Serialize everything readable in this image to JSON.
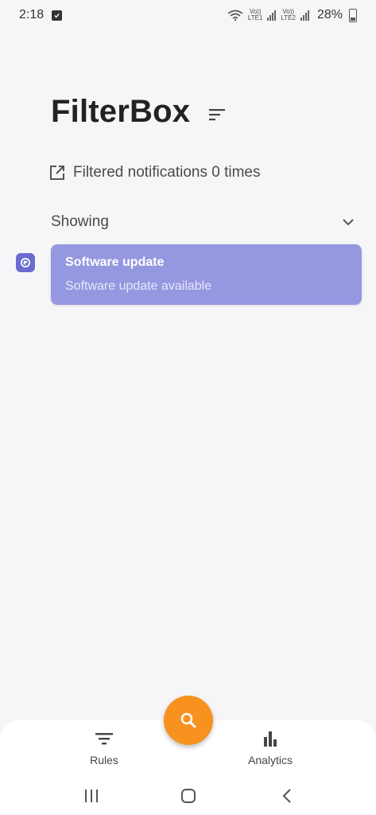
{
  "status_bar": {
    "time": "2:18",
    "network_tag_1_top": "Vo))",
    "network_tag_1_bottom": "LTE1",
    "network_tag_2_top": "Vo))",
    "network_tag_2_bottom": "LTE2",
    "battery": "28%"
  },
  "header": {
    "title": "FilterBox",
    "filtered_text": "Filtered notifications 0 times"
  },
  "section": {
    "label": "Showing"
  },
  "notifications": [
    {
      "title": "Software update",
      "body": "Software update available"
    }
  ],
  "bottom_nav": {
    "rules_label": "Rules",
    "analytics_label": "Analytics"
  },
  "colors": {
    "accent": "#f7921e",
    "card": "#9598e0",
    "app_icon": "#6b6ccf"
  },
  "icons": [
    "sort-icon",
    "open-external-icon",
    "chevron-down-icon",
    "search-icon",
    "filter-icon",
    "bar-chart-icon",
    "recents-icon",
    "home-icon",
    "back-icon"
  ]
}
